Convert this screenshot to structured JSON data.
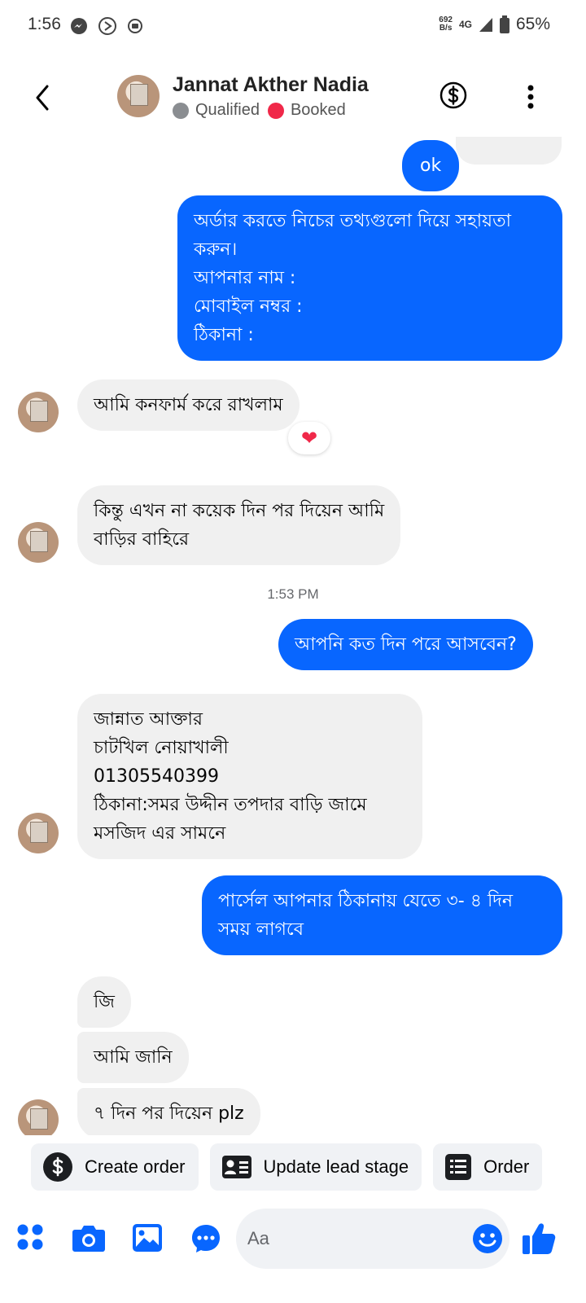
{
  "status_bar": {
    "time": "1:56",
    "net_speed_top": "692",
    "net_speed_bottom": "B/s",
    "network": "4G",
    "battery": "65%"
  },
  "header": {
    "contact_name": "Jannat Akther Nadia",
    "stages": [
      "Qualified",
      "Booked"
    ]
  },
  "messages": {
    "m0": "ok",
    "m1": "অর্ডার করতে নিচের তথ্যগুলো দিয়ে সহায়তা\nকরুন।\nআপনার নাম :\nমোবাইল নম্বর :\nঠিকানা :",
    "m2": "আমি কনফার্ম করে রাখলাম",
    "m2_reaction": "❤",
    "m3": "কিন্তু এখন না কয়েক দিন পর দিয়েন আমি\nবাড়ির বাহিরে",
    "time1": "1:53 PM",
    "m4": "আপনি কত দিন পরে আসবেন?",
    "m5": "জান্নাত আক্তার\nচাটখিল নোয়াখালী\n01305540399\nঠিকানা:সমর উদ্দীন তপদার বাড়ি জামে\nমসজিদ এর সামনে",
    "m6": "পার্সেল আপনার ঠিকানায় যেতে ৩- ৪ দিন\nসময় লাগবে",
    "m7": "জি",
    "m8": "আমি জানি",
    "m9": "৭ দিন পর দিয়েন plz"
  },
  "quick_actions": [
    "Create order",
    "Update lead stage",
    "Order"
  ],
  "composer": {
    "placeholder": "Aa"
  },
  "colors": {
    "accent": "#0866ff",
    "incoming_bubble": "#f0f0f0",
    "booked": "#f02849",
    "qualified": "#8a8d91"
  }
}
